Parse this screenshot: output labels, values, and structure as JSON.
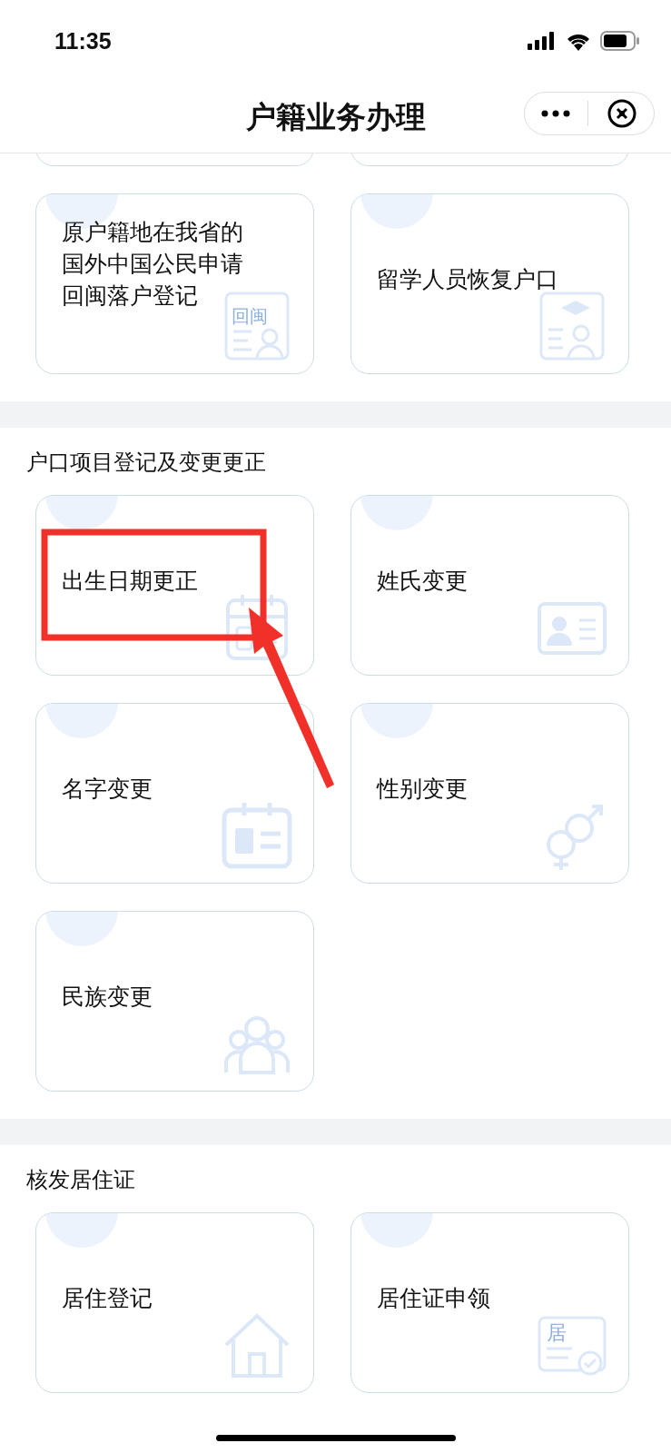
{
  "status_bar": {
    "time": "11:35"
  },
  "header": {
    "title": "户籍业务办理"
  },
  "sections": [
    {
      "items": [
        {
          "label": "原户籍地在我省的国外中国公民申请回闽落户登记",
          "icon_text": "回闽"
        },
        {
          "label": "留学人员恢复户口"
        }
      ]
    },
    {
      "title": "户口项目登记及变更更正",
      "items": [
        {
          "label": "出生日期更正"
        },
        {
          "label": "姓氏变更"
        },
        {
          "label": "名字变更"
        },
        {
          "label": "性别变更"
        },
        {
          "label": "民族变更"
        }
      ]
    },
    {
      "title": "核发居住证",
      "items": [
        {
          "label": "居住登记"
        },
        {
          "label": "居住证申领",
          "icon_text": "居"
        }
      ]
    }
  ]
}
